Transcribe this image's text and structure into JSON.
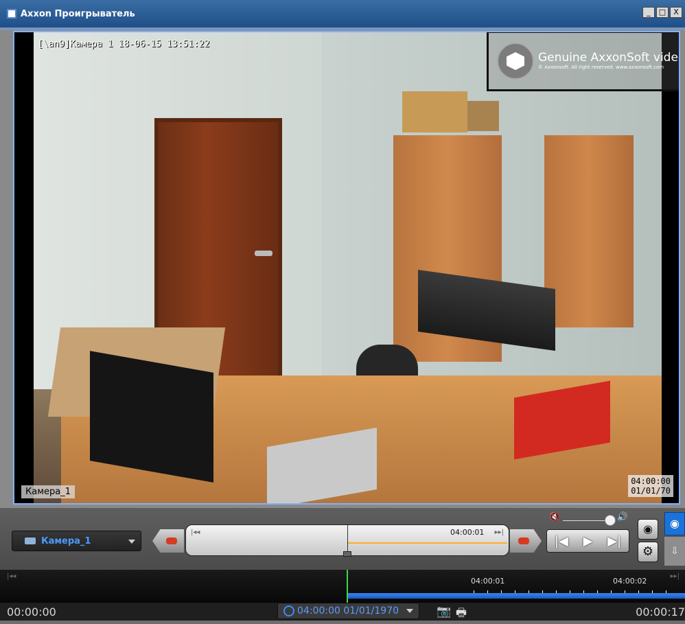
{
  "window": {
    "title": "Axxon Проигрыватель",
    "minimize": "_",
    "maximize": "□",
    "close": "X"
  },
  "video": {
    "osd_camera_line": "[\\an9]Камера 1 18-06-15 13:51:22",
    "watermark_title": "Genuine AxxonSoft video",
    "watermark_subtitle": "© Axxonsoft. All right reserved. www.axxonsoft.com",
    "camera_label": "Камера_1",
    "time_line1": "04:00:00",
    "time_line2": "01/01/70"
  },
  "controls": {
    "camera_selector": "Камера_1",
    "mini_timeline_time": "04:00:01",
    "mini_left_marker": "|◂◂",
    "mini_right_marker": "▸▸|",
    "transport_first": "|◀",
    "transport_play": "▶",
    "transport_last": "▶|"
  },
  "timeline": {
    "left_marker": "|◂◂",
    "right_marker": "▸▸|",
    "tick1": "04:00:01",
    "tick2": "04:00:02"
  },
  "status": {
    "elapsed": "00:00:00",
    "datetime": "04:00:00 01/01/1970",
    "total": "00:00:17"
  },
  "icons": {
    "mute": "mute-icon",
    "volume": "volume-icon",
    "eye": "eye-icon",
    "gear": "gear-icon",
    "play_mode": "play-circle-icon",
    "download": "download-icon",
    "camera": "camera-icon",
    "print": "print-icon",
    "clock": "clock-icon"
  },
  "colors": {
    "title_bar": "#1f4f88",
    "accent_blue": "#1a73d8",
    "timeline_blue": "#3a83f0",
    "cursor_green": "#3ed84a",
    "orange_progress": "#ffad24"
  }
}
